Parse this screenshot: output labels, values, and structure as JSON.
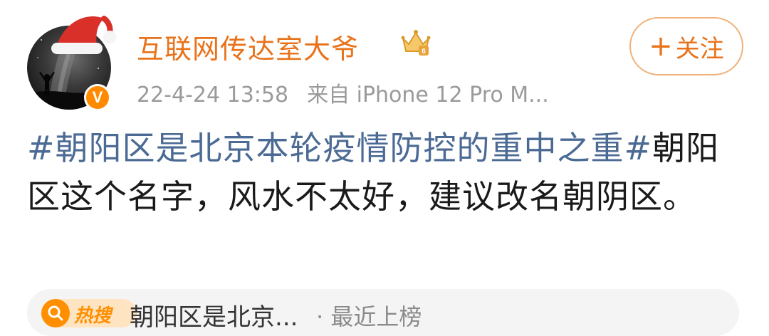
{
  "user": {
    "name": "互联网传达室大爷",
    "verified_badge": "V",
    "time": "22-4-24 13:58",
    "source": "来自 iPhone 12 Pro M..."
  },
  "follow": {
    "plus": "+",
    "label": "关注"
  },
  "post": {
    "hashtag": "#朝阳区是北京本轮疫情防控的重中之重#",
    "text": "朝阳区这个名字，风水不太好，建议改名朝阴区。"
  },
  "hot_search": {
    "chip_label": "热搜",
    "topic": "朝阳区是北京...",
    "status": "· 最近上榜"
  },
  "colors": {
    "username": "#e8731a",
    "hashtag": "#4b6a94",
    "badge": "#ff8a00",
    "meta": "#9a9a9a"
  }
}
